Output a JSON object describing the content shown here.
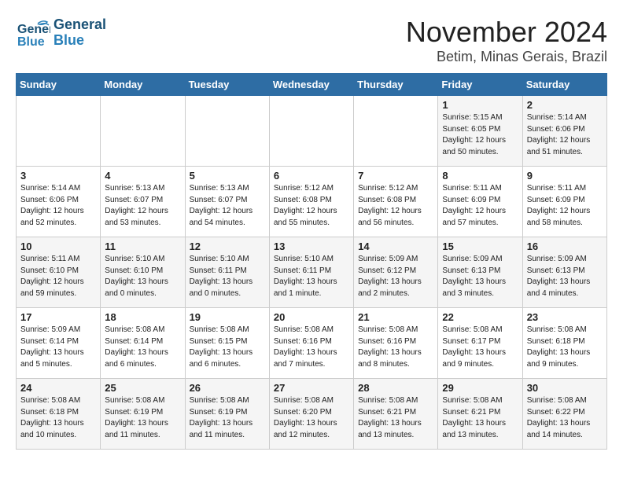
{
  "logo": {
    "line1": "General",
    "line2": "Blue"
  },
  "title": "November 2024",
  "location": "Betim, Minas Gerais, Brazil",
  "weekdays": [
    "Sunday",
    "Monday",
    "Tuesday",
    "Wednesday",
    "Thursday",
    "Friday",
    "Saturday"
  ],
  "weeks": [
    [
      {
        "day": "",
        "info": ""
      },
      {
        "day": "",
        "info": ""
      },
      {
        "day": "",
        "info": ""
      },
      {
        "day": "",
        "info": ""
      },
      {
        "day": "",
        "info": ""
      },
      {
        "day": "1",
        "info": "Sunrise: 5:15 AM\nSunset: 6:05 PM\nDaylight: 12 hours\nand 50 minutes."
      },
      {
        "day": "2",
        "info": "Sunrise: 5:14 AM\nSunset: 6:06 PM\nDaylight: 12 hours\nand 51 minutes."
      }
    ],
    [
      {
        "day": "3",
        "info": "Sunrise: 5:14 AM\nSunset: 6:06 PM\nDaylight: 12 hours\nand 52 minutes."
      },
      {
        "day": "4",
        "info": "Sunrise: 5:13 AM\nSunset: 6:07 PM\nDaylight: 12 hours\nand 53 minutes."
      },
      {
        "day": "5",
        "info": "Sunrise: 5:13 AM\nSunset: 6:07 PM\nDaylight: 12 hours\nand 54 minutes."
      },
      {
        "day": "6",
        "info": "Sunrise: 5:12 AM\nSunset: 6:08 PM\nDaylight: 12 hours\nand 55 minutes."
      },
      {
        "day": "7",
        "info": "Sunrise: 5:12 AM\nSunset: 6:08 PM\nDaylight: 12 hours\nand 56 minutes."
      },
      {
        "day": "8",
        "info": "Sunrise: 5:11 AM\nSunset: 6:09 PM\nDaylight: 12 hours\nand 57 minutes."
      },
      {
        "day": "9",
        "info": "Sunrise: 5:11 AM\nSunset: 6:09 PM\nDaylight: 12 hours\nand 58 minutes."
      }
    ],
    [
      {
        "day": "10",
        "info": "Sunrise: 5:11 AM\nSunset: 6:10 PM\nDaylight: 12 hours\nand 59 minutes."
      },
      {
        "day": "11",
        "info": "Sunrise: 5:10 AM\nSunset: 6:10 PM\nDaylight: 13 hours\nand 0 minutes."
      },
      {
        "day": "12",
        "info": "Sunrise: 5:10 AM\nSunset: 6:11 PM\nDaylight: 13 hours\nand 0 minutes."
      },
      {
        "day": "13",
        "info": "Sunrise: 5:10 AM\nSunset: 6:11 PM\nDaylight: 13 hours\nand 1 minute."
      },
      {
        "day": "14",
        "info": "Sunrise: 5:09 AM\nSunset: 6:12 PM\nDaylight: 13 hours\nand 2 minutes."
      },
      {
        "day": "15",
        "info": "Sunrise: 5:09 AM\nSunset: 6:13 PM\nDaylight: 13 hours\nand 3 minutes."
      },
      {
        "day": "16",
        "info": "Sunrise: 5:09 AM\nSunset: 6:13 PM\nDaylight: 13 hours\nand 4 minutes."
      }
    ],
    [
      {
        "day": "17",
        "info": "Sunrise: 5:09 AM\nSunset: 6:14 PM\nDaylight: 13 hours\nand 5 minutes."
      },
      {
        "day": "18",
        "info": "Sunrise: 5:08 AM\nSunset: 6:14 PM\nDaylight: 13 hours\nand 6 minutes."
      },
      {
        "day": "19",
        "info": "Sunrise: 5:08 AM\nSunset: 6:15 PM\nDaylight: 13 hours\nand 6 minutes."
      },
      {
        "day": "20",
        "info": "Sunrise: 5:08 AM\nSunset: 6:16 PM\nDaylight: 13 hours\nand 7 minutes."
      },
      {
        "day": "21",
        "info": "Sunrise: 5:08 AM\nSunset: 6:16 PM\nDaylight: 13 hours\nand 8 minutes."
      },
      {
        "day": "22",
        "info": "Sunrise: 5:08 AM\nSunset: 6:17 PM\nDaylight: 13 hours\nand 9 minutes."
      },
      {
        "day": "23",
        "info": "Sunrise: 5:08 AM\nSunset: 6:18 PM\nDaylight: 13 hours\nand 9 minutes."
      }
    ],
    [
      {
        "day": "24",
        "info": "Sunrise: 5:08 AM\nSunset: 6:18 PM\nDaylight: 13 hours\nand 10 minutes."
      },
      {
        "day": "25",
        "info": "Sunrise: 5:08 AM\nSunset: 6:19 PM\nDaylight: 13 hours\nand 11 minutes."
      },
      {
        "day": "26",
        "info": "Sunrise: 5:08 AM\nSunset: 6:19 PM\nDaylight: 13 hours\nand 11 minutes."
      },
      {
        "day": "27",
        "info": "Sunrise: 5:08 AM\nSunset: 6:20 PM\nDaylight: 13 hours\nand 12 minutes."
      },
      {
        "day": "28",
        "info": "Sunrise: 5:08 AM\nSunset: 6:21 PM\nDaylight: 13 hours\nand 13 minutes."
      },
      {
        "day": "29",
        "info": "Sunrise: 5:08 AM\nSunset: 6:21 PM\nDaylight: 13 hours\nand 13 minutes."
      },
      {
        "day": "30",
        "info": "Sunrise: 5:08 AM\nSunset: 6:22 PM\nDaylight: 13 hours\nand 14 minutes."
      }
    ]
  ]
}
